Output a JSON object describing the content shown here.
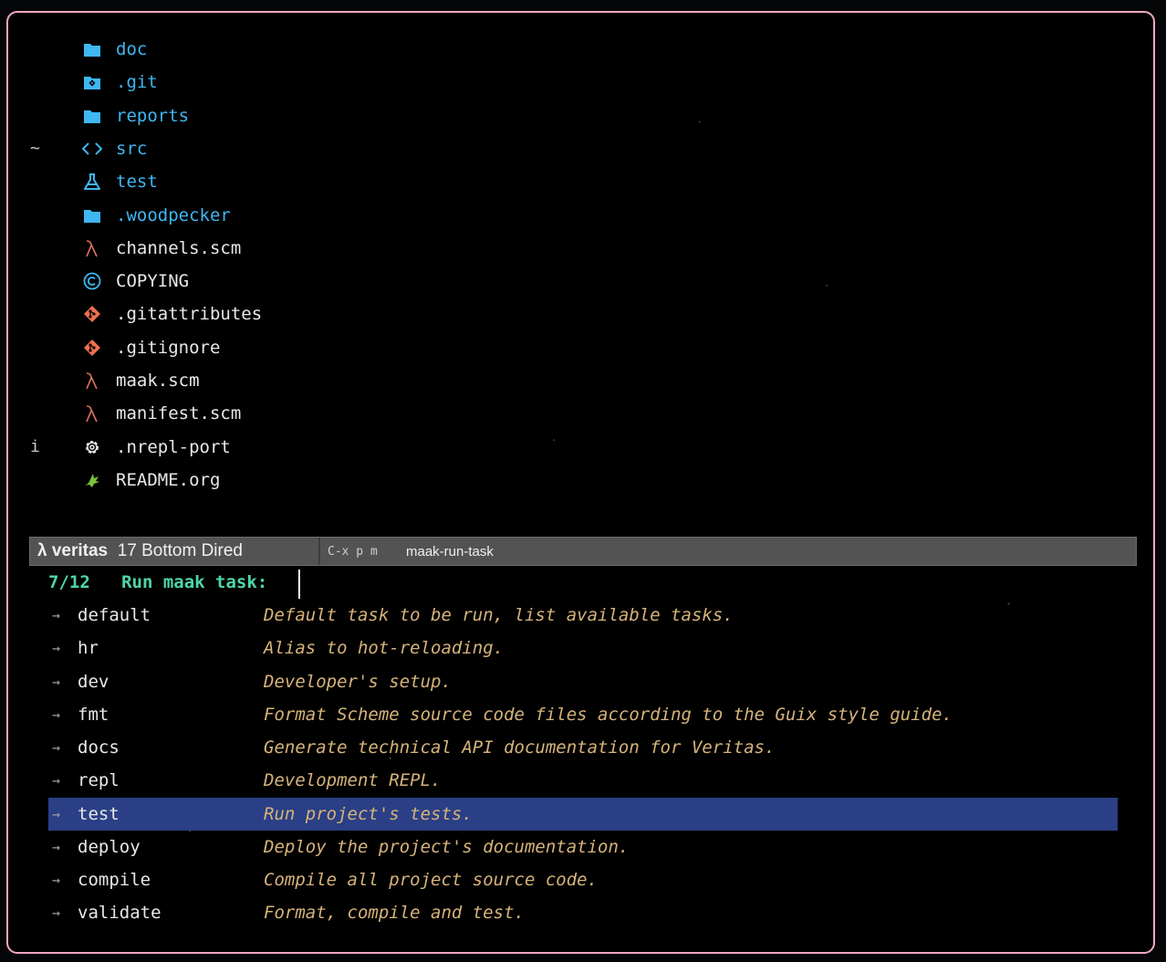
{
  "colors": {
    "frame_border": "#f2a8c4",
    "directory": "#3fb7f3",
    "lambda": "#e0735f",
    "git": "#f07050",
    "prompt": "#4fd6a8",
    "description": "#d6b37a",
    "selection": "#2a3f86",
    "modeline_bg": "#535353"
  },
  "dired": {
    "entries": [
      {
        "fringe": "",
        "icon": "folder-icon",
        "name": "doc",
        "kind": "dir"
      },
      {
        "fringe": "",
        "icon": "git-folder-icon",
        "name": ".git",
        "kind": "dir"
      },
      {
        "fringe": "",
        "icon": "folder-icon",
        "name": "reports",
        "kind": "dir"
      },
      {
        "fringe": "~",
        "icon": "code-brackets-icon",
        "name": "src",
        "kind": "dir"
      },
      {
        "fringe": "",
        "icon": "flask-icon",
        "name": "test",
        "kind": "dir"
      },
      {
        "fringe": "",
        "icon": "folder-icon",
        "name": ".woodpecker",
        "kind": "dir"
      },
      {
        "fringe": "",
        "icon": "lambda-icon",
        "name": "channels.scm",
        "kind": "file"
      },
      {
        "fringe": "",
        "icon": "copyright-icon",
        "name": "COPYING",
        "kind": "file"
      },
      {
        "fringe": "",
        "icon": "git-icon",
        "name": ".gitattributes",
        "kind": "file"
      },
      {
        "fringe": "",
        "icon": "git-icon",
        "name": ".gitignore",
        "kind": "file"
      },
      {
        "fringe": "",
        "icon": "lambda-icon",
        "name": "maak.scm",
        "kind": "file"
      },
      {
        "fringe": "",
        "icon": "lambda-icon",
        "name": "manifest.scm",
        "kind": "file"
      },
      {
        "fringe": "i",
        "icon": "gear-icon",
        "name": ".nrepl-port",
        "kind": "file"
      },
      {
        "fringe": "",
        "icon": "org-unicorn-icon",
        "name": "README.org",
        "kind": "file"
      }
    ]
  },
  "modeline": {
    "lambda": "λ",
    "buffer": "veritas",
    "info": "17 Bottom Dired",
    "keys": "C-x p m",
    "command": "maak-run-task"
  },
  "minibuffer": {
    "count": "7/12",
    "prompt": "Run maak task:",
    "selected_index": 6,
    "candidates": [
      {
        "name": "default",
        "desc": "Default task to be run, list available tasks."
      },
      {
        "name": "hr",
        "desc": "Alias to hot-reloading."
      },
      {
        "name": "dev",
        "desc": "Developer's setup."
      },
      {
        "name": "fmt",
        "desc": "Format Scheme source code files according to the Guix style guide."
      },
      {
        "name": "docs",
        "desc": "Generate technical API documentation for Veritas."
      },
      {
        "name": "repl",
        "desc": "Development REPL."
      },
      {
        "name": "test",
        "desc": "Run project's tests."
      },
      {
        "name": "deploy",
        "desc": "Deploy the project's documentation."
      },
      {
        "name": "compile",
        "desc": "Compile all project source code."
      },
      {
        "name": "validate",
        "desc": "Format, compile and test."
      }
    ]
  }
}
